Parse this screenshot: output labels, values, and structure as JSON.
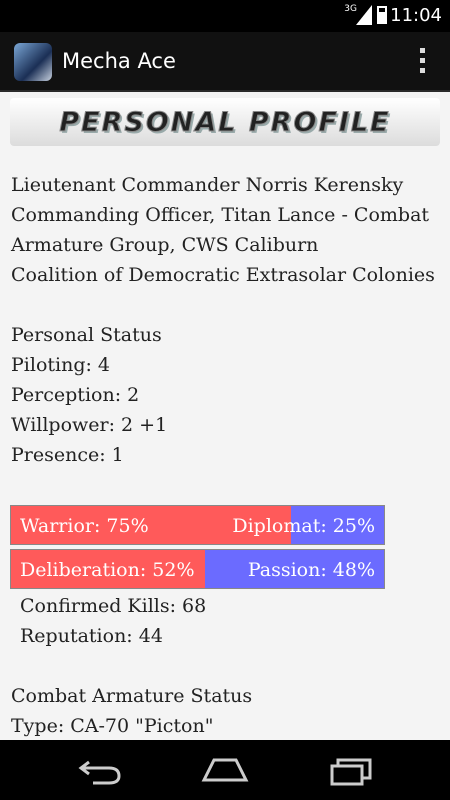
{
  "status_bar": {
    "time": "11:04",
    "network": "3G"
  },
  "app_bar": {
    "title": "Mecha Ace"
  },
  "banner": {
    "text": "PERSONAL PROFILE"
  },
  "profile": {
    "lines": [
      "Lieutenant Commander Norris Kerensky",
      "Commanding Officer, Titan Lance - Combat",
      "Armature Group, CWS Caliburn",
      "Coalition of Democratic Extrasolar Colonies"
    ]
  },
  "personal_status": {
    "heading": "Personal Status",
    "stats": [
      "Piloting: 4",
      "Perception: 2",
      "Willpower: 2 +1",
      "Presence: 1"
    ]
  },
  "bars": [
    {
      "left_label": "Warrior: 75%",
      "right_label": "Diplomat: 25%",
      "left_value": 0.75
    },
    {
      "left_label": "Deliberation: 52%",
      "right_label": "Passion: 48%",
      "left_value": 0.52
    }
  ],
  "record": {
    "kills": "Confirmed Kills: 68",
    "reputation": "Reputation: 44"
  },
  "armature_status": {
    "heading": "Combat Armature Status",
    "type": "Type: CA-70 \"Picton\""
  },
  "colors": {
    "left_bar": "#ff5a5a",
    "right_bar": "#6b6bff"
  }
}
